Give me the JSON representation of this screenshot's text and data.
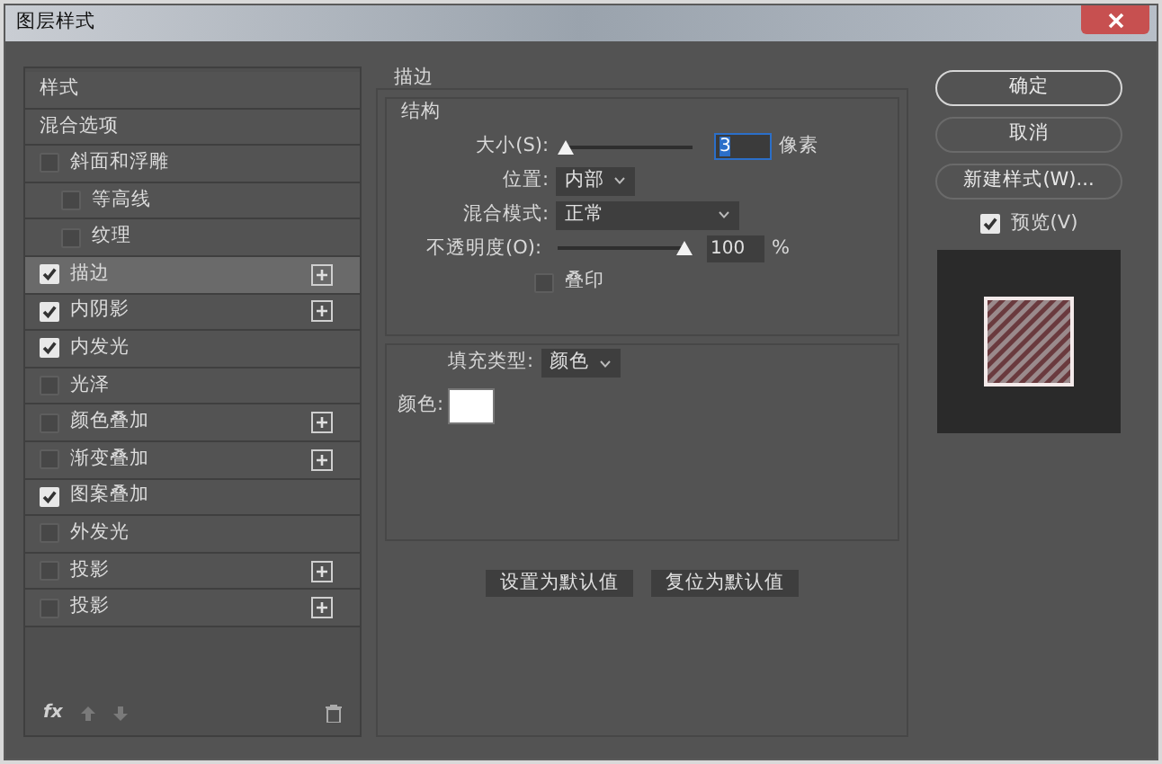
{
  "window": {
    "title": "图层样式"
  },
  "styles_list": [
    {
      "label": "样式",
      "kind": "header",
      "selected": false
    },
    {
      "label": "混合选项",
      "kind": "header",
      "selected": false
    },
    {
      "label": "斜面和浮雕",
      "kind": "checkbox",
      "checked": false,
      "selected": false,
      "add_button": false,
      "children": [
        {
          "label": "等高线",
          "kind": "checkbox",
          "checked": false,
          "selected": false,
          "add_button": false
        },
        {
          "label": "纹理",
          "kind": "checkbox",
          "checked": false,
          "selected": false,
          "add_button": false
        }
      ]
    },
    {
      "label": "描边",
      "kind": "checkbox",
      "checked": true,
      "selected": true,
      "add_button": true
    },
    {
      "label": "内阴影",
      "kind": "checkbox",
      "checked": true,
      "selected": false,
      "add_button": true
    },
    {
      "label": "内发光",
      "kind": "checkbox",
      "checked": true,
      "selected": false,
      "add_button": false
    },
    {
      "label": "光泽",
      "kind": "checkbox",
      "checked": false,
      "selected": false,
      "add_button": false
    },
    {
      "label": "颜色叠加",
      "kind": "checkbox",
      "checked": false,
      "selected": false,
      "add_button": true
    },
    {
      "label": "渐变叠加",
      "kind": "checkbox",
      "checked": false,
      "selected": false,
      "add_button": true
    },
    {
      "label": "图案叠加",
      "kind": "checkbox",
      "checked": true,
      "selected": false,
      "add_button": false
    },
    {
      "label": "外发光",
      "kind": "checkbox",
      "checked": false,
      "selected": false,
      "add_button": false
    },
    {
      "label": "投影",
      "kind": "checkbox",
      "checked": false,
      "selected": false,
      "add_button": true
    },
    {
      "label": "投影",
      "kind": "checkbox",
      "checked": false,
      "selected": false,
      "add_button": true
    }
  ],
  "list_footer": {
    "fx": "fx"
  },
  "stroke": {
    "title": "描边",
    "structure": {
      "title": "结构",
      "size": {
        "label": "大小(S):",
        "level": 0.02,
        "value": "3",
        "unit": "像素"
      },
      "position": {
        "label": "位置:",
        "value": "内部"
      },
      "blend_mode": {
        "label": "混合模式:",
        "value": "正常"
      },
      "opacity": {
        "label": "不透明度(O):",
        "level": 1,
        "value": "100",
        "unit": "%"
      },
      "overprint": {
        "label": "叠印",
        "checked": false
      }
    },
    "fill_type": {
      "label": "填充类型:",
      "value": "颜色"
    },
    "color": {
      "label": "颜色:",
      "color": "#ffffff"
    },
    "buttons": [
      "设置为默认值",
      "复位为默认值"
    ]
  },
  "actions": [
    {
      "label": "确定",
      "default": true
    },
    {
      "label": "取消",
      "default": false
    },
    {
      "label": "新建样式(W)...",
      "default": false
    }
  ],
  "preview": {
    "label": "预览(V)",
    "checked": true
  }
}
